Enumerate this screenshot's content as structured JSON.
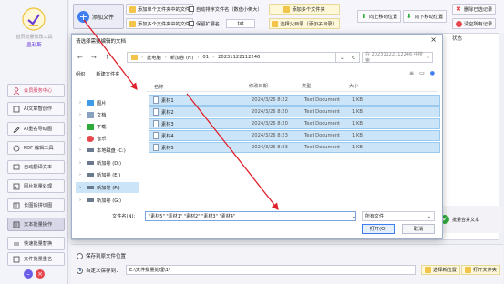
{
  "sidebar": {
    "app_title": "首页批量修改工具",
    "user_name": "墨利斯",
    "items": [
      {
        "label": "会员服务中心",
        "icon": "user-icon"
      },
      {
        "label": "AI文章智创作",
        "icon": "doc-ai-icon"
      },
      {
        "label": "AI重名导动图",
        "icon": "pen-icon"
      },
      {
        "label": "PDF 编辑工具",
        "icon": "pdf-icon"
      },
      {
        "label": "自动翻译文本",
        "icon": "monitor-icon"
      },
      {
        "label": "图片批量处理",
        "icon": "image-icon"
      },
      {
        "label": "长图拆拼切图",
        "icon": "split-icon"
      },
      {
        "label": "文本批量操作",
        "icon": "text-icon"
      },
      {
        "label": "快速批量替换",
        "icon": "replace-icon"
      },
      {
        "label": "文件批量重名",
        "icon": "rename-icon"
      }
    ]
  },
  "toolbar": {
    "add_file": "添加文件",
    "add_single_folder_files": "添加单个文件夹中的文件",
    "add_multi_folder_files": "添加多个文件夹中的文件",
    "auto_sort_name": "自动排序文件名（数值小倒大）",
    "keep_ext": "保留扩展名：",
    "ext_value": "txt",
    "add_multi_folder": "添加多个文件夹",
    "choose_parent_dir": "选择父目录（添加子目录）",
    "move_up": "向上移动位置",
    "move_down": "向下移动位置",
    "delete_selected": "删除已选记录",
    "clear_all": "清空所有记录"
  },
  "main": {
    "status_header": "状态",
    "merge_label": "批量合并文本"
  },
  "bottom": {
    "save_to_original": "保存到原文件位置",
    "custom_save_dir": "自定义保存到：",
    "save_path": "E:\\文件批量处理\\1\\",
    "choose_dir": "选择新位置",
    "open_folder": "打开文件夹"
  },
  "dialog": {
    "title": "请选择需要编辑的文档",
    "address": [
      "此电脑",
      "新加卷 (F:)",
      "01",
      "20231122112246"
    ],
    "search_placeholder": "在 20231122112246 中搜索",
    "organize": "组织",
    "new_folder": "新建文件夹",
    "tree": [
      {
        "label": "图片",
        "icon": "picture-folder-icon"
      },
      {
        "label": "文档",
        "icon": "document-folder-icon"
      },
      {
        "label": "下载",
        "icon": "download-folder-icon"
      },
      {
        "label": "音乐",
        "icon": "music-folder-icon"
      },
      {
        "label": "本地磁盘 (C:)",
        "icon": "drive-icon"
      },
      {
        "label": "新加卷 (D:)",
        "icon": "drive-icon"
      },
      {
        "label": "新加卷 (E:)",
        "icon": "drive-icon"
      },
      {
        "label": "新加卷 (F:)",
        "icon": "drive-icon"
      },
      {
        "label": "新加卷 (G:)",
        "icon": "drive-icon"
      }
    ],
    "columns": [
      "名称",
      "修改日期",
      "类型",
      "大小"
    ],
    "files": [
      {
        "name": "素材1",
        "date": "2024/3/26 8:22",
        "type": "Text Document",
        "size": "1 KB"
      },
      {
        "name": "素材2",
        "date": "2024/3/26 8:20",
        "type": "Text Document",
        "size": "1 KB"
      },
      {
        "name": "素材3",
        "date": "2024/3/26 8:20",
        "type": "Text Document",
        "size": "1 KB"
      },
      {
        "name": "素材4",
        "date": "2024/3/26 8:23",
        "type": "Text Document",
        "size": "1 KB"
      },
      {
        "name": "素材5",
        "date": "2024/3/26 8:23",
        "type": "Text Document",
        "size": "1 KB"
      }
    ],
    "filename_label": "文件名(N):",
    "filename_value": "\"素材5\" \"素材1\" \"素材2\" \"素材3\" \"素材4\"",
    "file_type": "所有文件",
    "open_button": "打开(O)",
    "cancel_button": "取消"
  },
  "colors": {
    "accent_blue": "#3f7ef0",
    "selection_blue": "#cce4f7",
    "annotation_red": "#e0202a",
    "member_red": "#d13b5a",
    "user_purple": "#6a3fd6"
  }
}
